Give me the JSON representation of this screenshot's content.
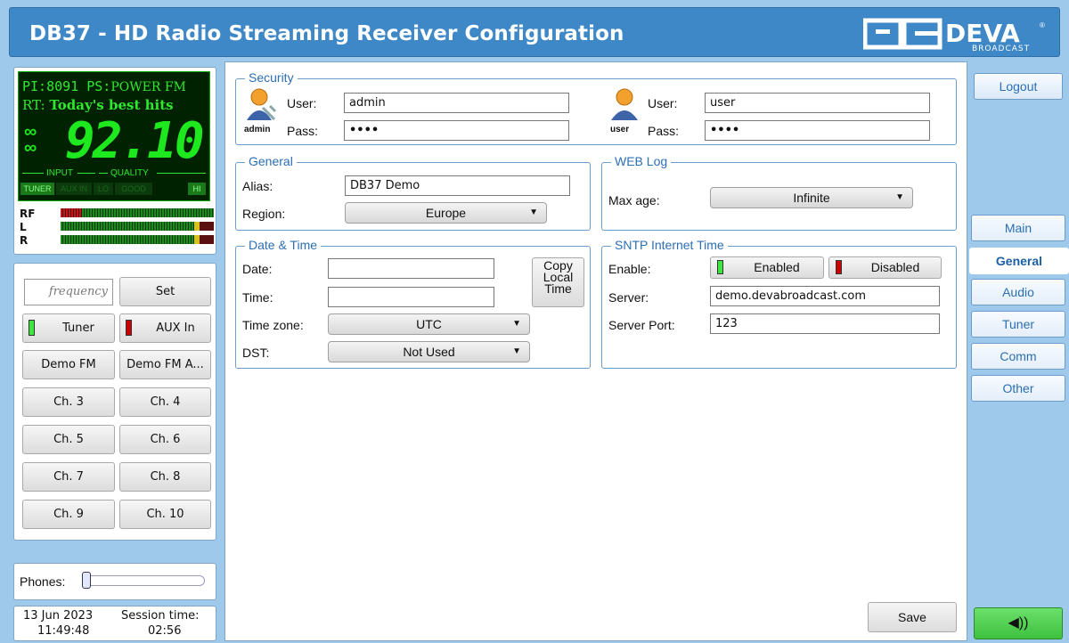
{
  "header": {
    "title": "DB37 - HD Radio Streaming Receiver Configuration",
    "brand": "DEVA",
    "brand_sub": "BROADCAST"
  },
  "display": {
    "pi_label": "PI:",
    "pi_value": "8091",
    "ps_label": "PS:",
    "ps_value": "POWER FM",
    "rt_label": "RT:",
    "rt_value": "Today's best hits",
    "frequency": "92.10",
    "input_label": "INPUT",
    "quality_label": "QUALITY",
    "indicators": [
      "TUNER",
      "AUX IN",
      "LO",
      "GOOD",
      "HI"
    ],
    "meters": [
      "RF",
      "L",
      "R"
    ]
  },
  "controls": {
    "frequency_placeholder": "frequency",
    "set_label": "Set",
    "tuner_label": "Tuner",
    "aux_label": "AUX In",
    "channels": [
      "Demo FM",
      "Demo FM A...",
      "Ch. 3",
      "Ch. 4",
      "Ch. 5",
      "Ch. 6",
      "Ch. 7",
      "Ch. 8",
      "Ch. 9",
      "Ch. 10"
    ]
  },
  "phones": {
    "label": "Phones:",
    "level": 0
  },
  "status": {
    "date": "13 Jun 2023",
    "time": "11:49:48",
    "session_label": "Session time:",
    "session_time": "02:56"
  },
  "security": {
    "legend": "Security",
    "admin": {
      "role": "admin",
      "user_label": "User:",
      "user_value": "admin",
      "pass_label": "Pass:",
      "pass_value": "••••"
    },
    "user": {
      "role": "user",
      "user_label": "User:",
      "user_value": "user",
      "pass_label": "Pass:",
      "pass_value": "••••"
    }
  },
  "general": {
    "legend": "General",
    "alias_label": "Alias:",
    "alias_value": "DB37 Demo",
    "region_label": "Region:",
    "region_value": "Europe"
  },
  "weblog": {
    "legend": "WEB Log",
    "maxage_label": "Max age:",
    "maxage_value": "Infinite"
  },
  "datetime": {
    "legend": "Date & Time",
    "date_label": "Date:",
    "time_label": "Time:",
    "copy_label_1": "Copy",
    "copy_label_2": "Local",
    "copy_label_3": "Time",
    "tz_label": "Time zone:",
    "tz_value": "UTC",
    "dst_label": "DST:",
    "dst_value": "Not Used"
  },
  "sntp": {
    "legend": "SNTP Internet Time",
    "enable_label": "Enable:",
    "enabled_label": "Enabled",
    "disabled_label": "Disabled",
    "server_label": "Server:",
    "server_value": "demo.devabroadcast.com",
    "port_label": "Server Port:",
    "port_value": "123"
  },
  "save_label": "Save",
  "nav": {
    "logout": "Logout",
    "items": [
      "Main",
      "General",
      "Audio",
      "Tuner",
      "Comm",
      "Other"
    ],
    "active": "General"
  },
  "colors": {
    "header": "#3f88c7",
    "accent": "#2b6fb5",
    "background": "#9ec9ea",
    "led_green": "#3ce83c",
    "led_red": "#c00000"
  }
}
